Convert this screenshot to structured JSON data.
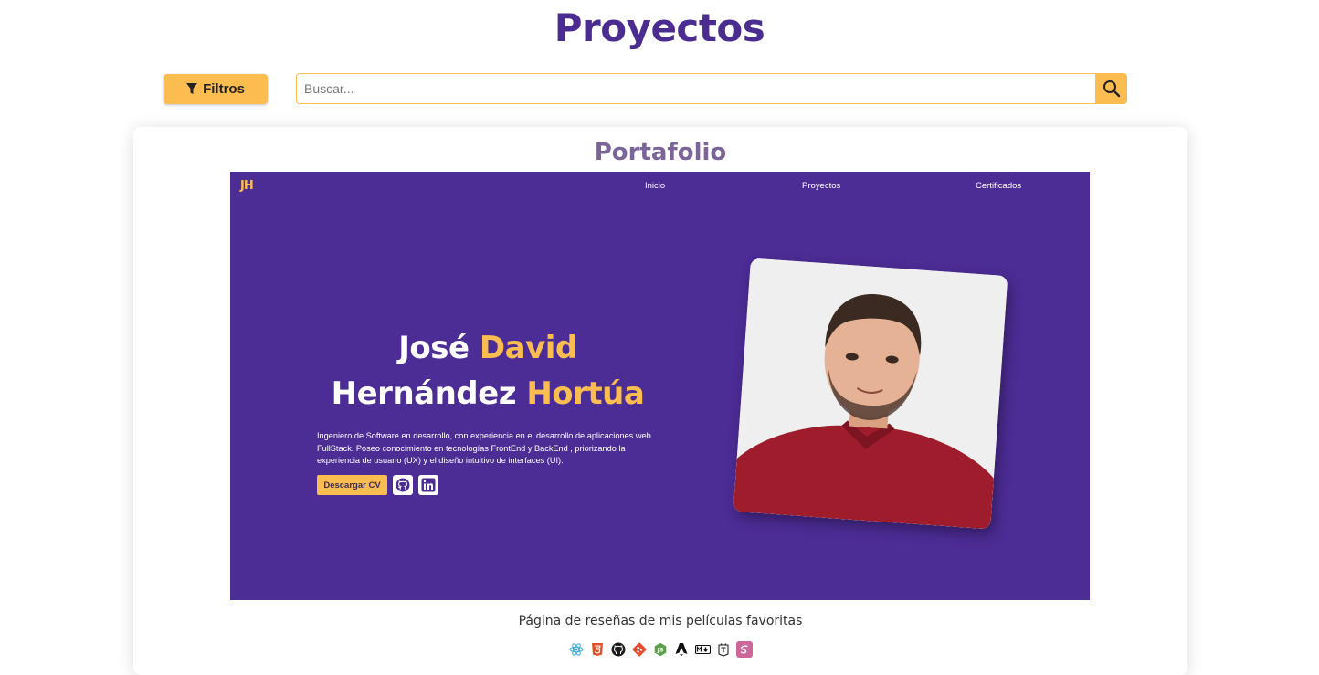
{
  "page": {
    "title": "Proyectos"
  },
  "toolbar": {
    "filter_label": "Filtros",
    "search_placeholder": "Buscar..."
  },
  "project": {
    "title": "Portafolio",
    "description": "Página de reseñas de mis películas favoritas",
    "preview": {
      "logo": "JH",
      "nav": [
        "Inicio",
        "Proyectos",
        "Certificados"
      ],
      "name_first": "José",
      "name_second": "David",
      "name_third": "Hernández",
      "name_fourth": "Hortúa",
      "bio": "Ingeniero de Software en desarrollo, con experiencia en el desarrollo de aplicaciones web FullStack. Poseo conocimiento en tecnologías FrontEnd y BackEnd , priorizando la experiencia de usuario (UX) y el diseño intuitivo de interfaces (UI).",
      "cv_button": "Descargar CV",
      "social_icons": [
        "github-icon",
        "linkedin-icon"
      ]
    },
    "technologies": [
      "react-icon",
      "html5-icon",
      "github-icon",
      "git-icon",
      "nodejs-icon",
      "astro-icon",
      "markdown-icon",
      "tailwind-icon",
      "sass-icon"
    ]
  },
  "colors": {
    "accent": "#fcbd50",
    "brand": "#4b2c91",
    "preview_bg": "#4c2c95"
  }
}
